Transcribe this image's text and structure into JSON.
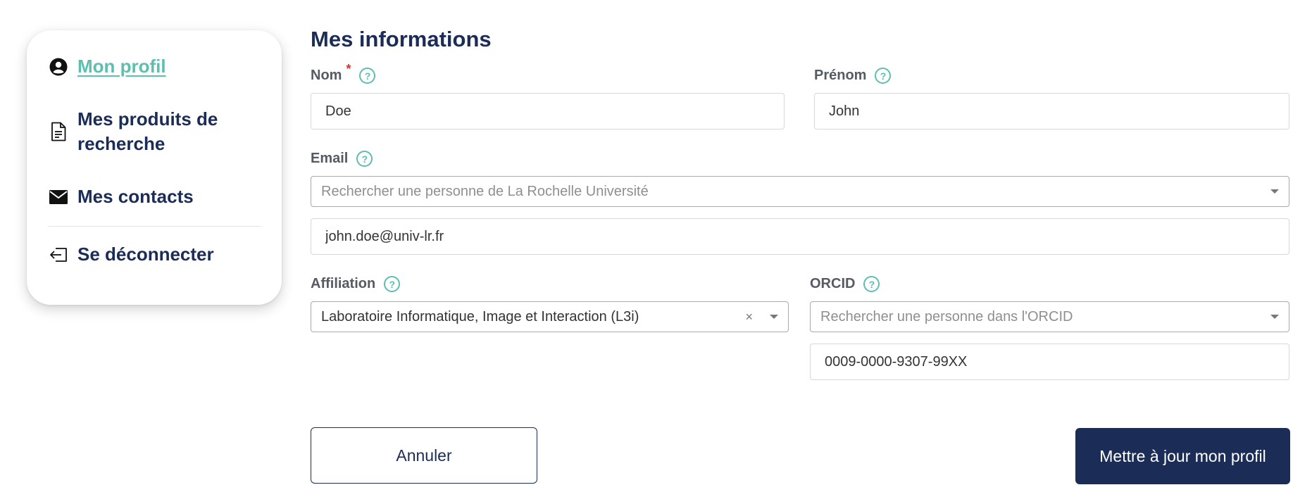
{
  "sidebar": {
    "items": [
      {
        "label": "Mon profil",
        "icon": "user-circle-icon"
      },
      {
        "label": "Mes produits de recherche",
        "icon": "document-icon"
      },
      {
        "label": "Mes contacts",
        "icon": "envelope-icon"
      },
      {
        "label": "Se déconnecter",
        "icon": "logout-icon"
      }
    ]
  },
  "form": {
    "title": "Mes informations",
    "nom": {
      "label": "Nom",
      "required_mark": "*",
      "value": "Doe"
    },
    "prenom": {
      "label": "Prénom",
      "value": "John"
    },
    "email": {
      "label": "Email",
      "search_placeholder": "Rechercher une personne de La Rochelle Université",
      "value": "john.doe@univ-lr.fr"
    },
    "affiliation": {
      "label": "Affiliation",
      "selected": "Laboratoire Informatique, Image et Interaction (L3i)",
      "clear_glyph": "×"
    },
    "orcid": {
      "label": "ORCID",
      "search_placeholder": "Rechercher une personne dans l'ORCID",
      "value": "0009-0000-9307-99XX"
    },
    "help_glyph": "?"
  },
  "actions": {
    "cancel_label": "Annuler",
    "update_label": "Mettre à jour mon profil"
  },
  "colors": {
    "primary": "#1b2c57",
    "accent": "#5cbfb0",
    "required": "#d9342b"
  }
}
